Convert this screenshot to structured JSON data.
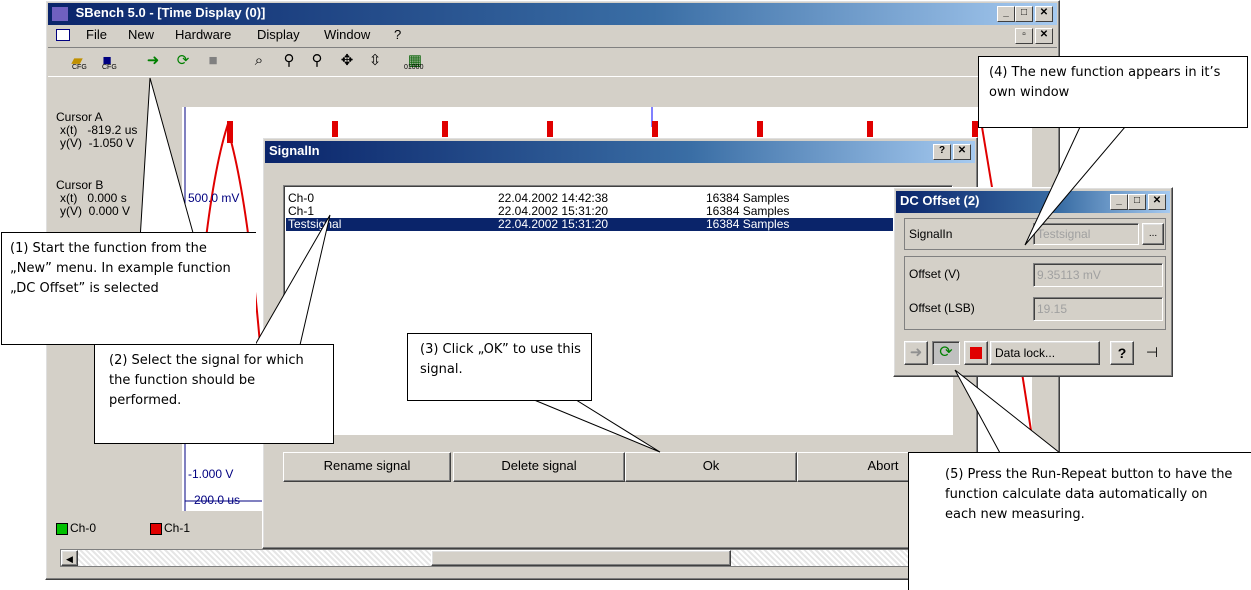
{
  "main_window": {
    "title": "SBench 5.0 - [Time Display (0)]",
    "menu": [
      "File",
      "New",
      "Hardware",
      "Display",
      "Window",
      "?"
    ],
    "cursor_a": {
      "label": "Cursor A",
      "x": "x(t)   -819.2 us",
      "y": "y(V)  -1.050 V"
    },
    "cursor_b": {
      "label": "Cursor B",
      "x": "x(t)   0.000 s",
      "y": "y(V)  0.000 V"
    },
    "y_top": "500.0 mV",
    "y_bottom": "-1.000 V",
    "x_left": "-200.0 us",
    "legend": [
      "Ch-0",
      "Ch-1"
    ],
    "toolbar_labels": [
      "CFG",
      "CFG",
      "01000"
    ]
  },
  "signal_dialog": {
    "title": "SignalIn",
    "rows": [
      {
        "name": "Ch-0",
        "date": "22.04.2002 14:42:38",
        "samples": "16384 Samples"
      },
      {
        "name": "Ch-1",
        "date": "22.04.2002 15:31:20",
        "samples": "16384 Samples"
      },
      {
        "name": "Testsignal",
        "date": "22.04.2002 15:31:20",
        "samples": "16384 Samples"
      }
    ],
    "buttons": {
      "rename": "Rename signal",
      "delete": "Delete signal",
      "ok": "Ok",
      "abort": "Abort"
    }
  },
  "dc_offset": {
    "title": "DC Offset (2)",
    "signalin_label": "SignalIn",
    "signalin_value": "Testsignal",
    "offset_v_label": "Offset (V)",
    "offset_v_value": "9.35113 mV",
    "offset_lsb_label": "Offset (LSB)",
    "offset_lsb_value": "19.15",
    "data_lock": "Data lock..."
  },
  "callouts": {
    "c1": "(1) Start the function from the „New” menu. In example function „DC Offset” is selected",
    "c2": "(2) Select the signal for which the function should be performed.",
    "c3": "(3) Click „OK” to use this signal.",
    "c4": "(4) The new function appears in it’s own window",
    "c5": "(5) Press the Run-Repeat button to have the function calculate data automatically on each new measuring."
  },
  "colors": {
    "title_active": "#0a246a",
    "selection": "#0a246a",
    "trace_red": "#e00000",
    "trace_green": "#00c000"
  }
}
